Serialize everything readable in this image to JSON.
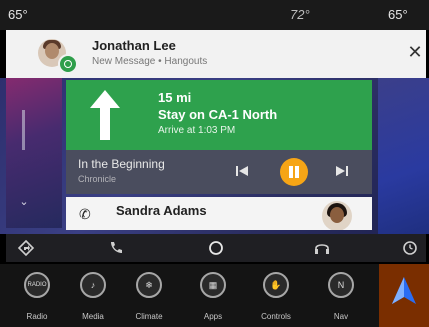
{
  "status": {
    "temp_left": "65°",
    "temp_center": "72°",
    "temp_right": "65°"
  },
  "notification": {
    "name": "Jonathan Lee",
    "subtitle": "New Message • Hangouts",
    "close_label": "✕"
  },
  "navigation": {
    "distance": "15 mi",
    "instruction": "Stay on CA-1 North",
    "arrival": "Arrive at 1:03 PM"
  },
  "media": {
    "track": "In the Beginning",
    "artist": "Chronicle"
  },
  "contact": {
    "name": "Sandra Adams"
  },
  "uconnect_nav": [
    {
      "label": "Radio",
      "icon": "radio-icon",
      "glyph": "RADIO"
    },
    {
      "label": "Media",
      "icon": "media-icon",
      "glyph": "♪"
    },
    {
      "label": "Climate",
      "icon": "climate-icon",
      "glyph": "❄"
    },
    {
      "label": "Apps",
      "icon": "apps-icon",
      "glyph": "▦"
    },
    {
      "label": "Controls",
      "icon": "controls-icon",
      "glyph": "✋"
    },
    {
      "label": "Nav",
      "icon": "nav-icon",
      "glyph": "N"
    }
  ],
  "colors": {
    "nav_green": "#2ea14d",
    "pause_orange": "#f6a516",
    "android_auto_blue": "#2a6df4"
  }
}
